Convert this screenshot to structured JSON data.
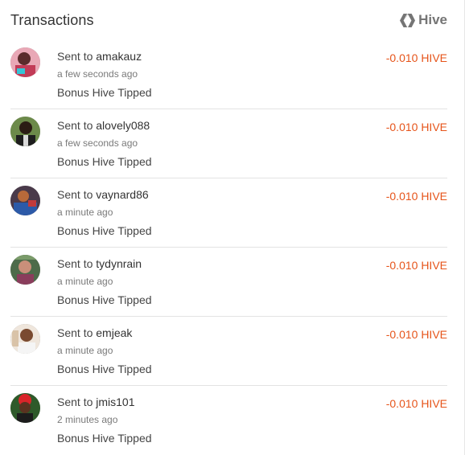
{
  "header": {
    "title": "Transactions",
    "brand_label": "Hive"
  },
  "colors": {
    "amount": "#e6541a",
    "brand": "#757575"
  },
  "transactions": [
    {
      "prefix": "Sent to",
      "user": "amakauz",
      "time": "a few seconds ago",
      "memo": "Bonus Hive Tipped",
      "amount": "-0.010 HIVE",
      "avatar": "pink-photo"
    },
    {
      "prefix": "Sent to",
      "user": "alovely088",
      "time": "a few seconds ago",
      "memo": "Bonus Hive Tipped",
      "amount": "-0.010 HIVE",
      "avatar": "green-photo"
    },
    {
      "prefix": "Sent to",
      "user": "vaynard86",
      "time": "a minute ago",
      "memo": "Bonus Hive Tipped",
      "amount": "-0.010 HIVE",
      "avatar": "blue-photo"
    },
    {
      "prefix": "Sent to",
      "user": "tydynrain",
      "time": "a minute ago",
      "memo": "Bonus Hive Tipped",
      "amount": "-0.010 HIVE",
      "avatar": "teal-photo"
    },
    {
      "prefix": "Sent to",
      "user": "emjeak",
      "time": "a minute ago",
      "memo": "Bonus Hive Tipped",
      "amount": "-0.010 HIVE",
      "avatar": "light-photo"
    },
    {
      "prefix": "Sent to",
      "user": "jmis101",
      "time": "2 minutes ago",
      "memo": "Bonus Hive Tipped",
      "amount": "-0.010 HIVE",
      "avatar": "red-photo"
    }
  ]
}
